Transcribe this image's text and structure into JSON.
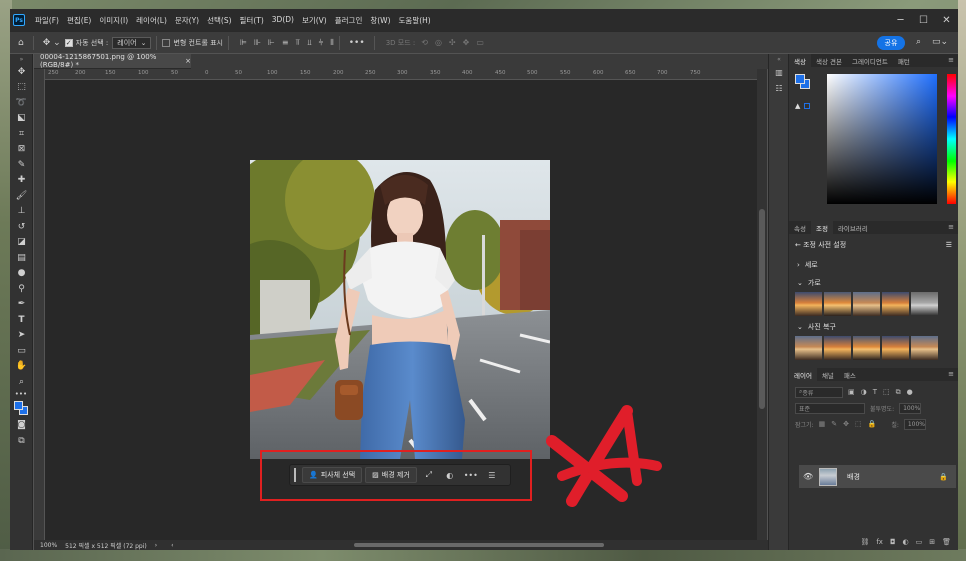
{
  "menubar": {
    "items": [
      "파일(F)",
      "편집(E)",
      "이미지(I)",
      "레이어(L)",
      "문자(Y)",
      "선택(S)",
      "필터(T)",
      "3D(D)",
      "보기(V)",
      "플러그인",
      "창(W)",
      "도움말(H)"
    ]
  },
  "optbar": {
    "auto_select_label": "자동 선택 :",
    "auto_select_value": "레이어",
    "transform_controls_label": "변형 컨트롤 표시",
    "mode_3d_label": "3D 모드 :",
    "share_label": "공유"
  },
  "document": {
    "tab_title": "00004-1215867501.png @ 100% (RGB/8#) *",
    "tab_close": "×",
    "zoom": "100%",
    "doc_info": "512 픽셀 x 512 픽셀 (72 ppi)",
    "ruler_ticks": [
      "250",
      "200",
      "150",
      "100",
      "50",
      "0",
      "50",
      "100",
      "150",
      "200",
      "250",
      "300",
      "350",
      "400",
      "450",
      "500",
      "550",
      "600",
      "650",
      "700",
      "750"
    ]
  },
  "context_bar": {
    "select_subject": "피사체 선택",
    "remove_background": "배경 제거"
  },
  "color_panel": {
    "tabs": [
      "색상",
      "색상 견본",
      "그레이디언트",
      "패턴"
    ]
  },
  "adjustments_panel": {
    "tabs": [
      "속성",
      "조정",
      "라이브러리"
    ],
    "header": "조정 사전 설정",
    "groups": [
      "세로",
      "가로",
      "사진 복구"
    ]
  },
  "layers_panel": {
    "tabs": [
      "레이어",
      "채널",
      "패스"
    ],
    "filter_placeholder": "종류",
    "blend_mode": "표준",
    "opacity_label": "불투명도:",
    "opacity_value": "100%",
    "lock_label": "잠그기:",
    "fill_label": "칠:",
    "fill_value": "100%",
    "layer_name": "배경"
  },
  "colors": {
    "foreground": "#1e70e8",
    "accent": "#1473e6",
    "annotation_red": "#e02020"
  }
}
